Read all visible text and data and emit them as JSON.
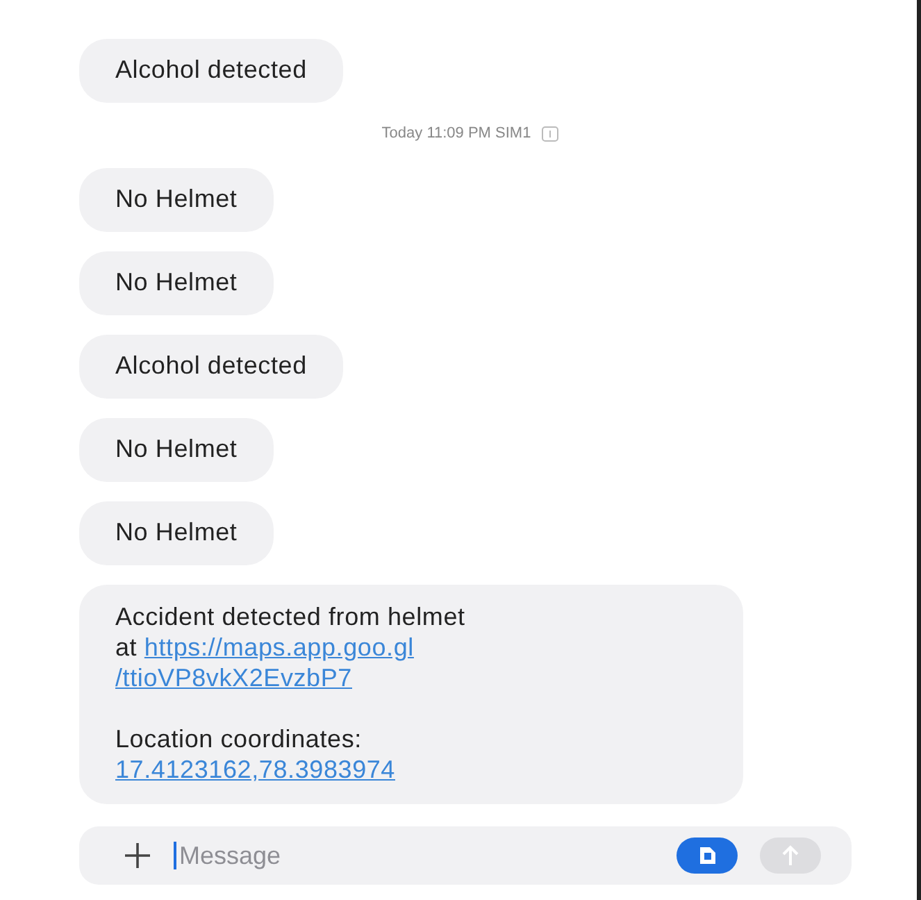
{
  "messages": [
    {
      "kind": "text",
      "text": "Alcohol detected"
    },
    {
      "kind": "timestamp",
      "text": "Today 11:09 PM  SIM1"
    },
    {
      "kind": "text",
      "text": "No Helmet"
    },
    {
      "kind": "text",
      "text": "No Helmet"
    },
    {
      "kind": "text",
      "text": "Alcohol detected"
    },
    {
      "kind": "text",
      "text": "No Helmet"
    },
    {
      "kind": "text",
      "text": "No Helmet"
    },
    {
      "kind": "rich",
      "paragraphs": [
        [
          [
            {
              "kind": "text",
              "text": "Accident detected from helmet"
            }
          ],
          [
            {
              "kind": "text",
              "text": "at "
            },
            {
              "kind": "link",
              "text": "https://maps.app.goo.gl"
            }
          ],
          [
            {
              "kind": "link",
              "text": "/ttioVP8vkX2EvzbP7"
            }
          ]
        ],
        [
          [
            {
              "kind": "text",
              "text": "Location coordinates:"
            }
          ],
          [
            {
              "kind": "link",
              "text": "17.4123162,78.3983974"
            }
          ]
        ]
      ]
    }
  ],
  "composer": {
    "placeholder": "Message"
  }
}
